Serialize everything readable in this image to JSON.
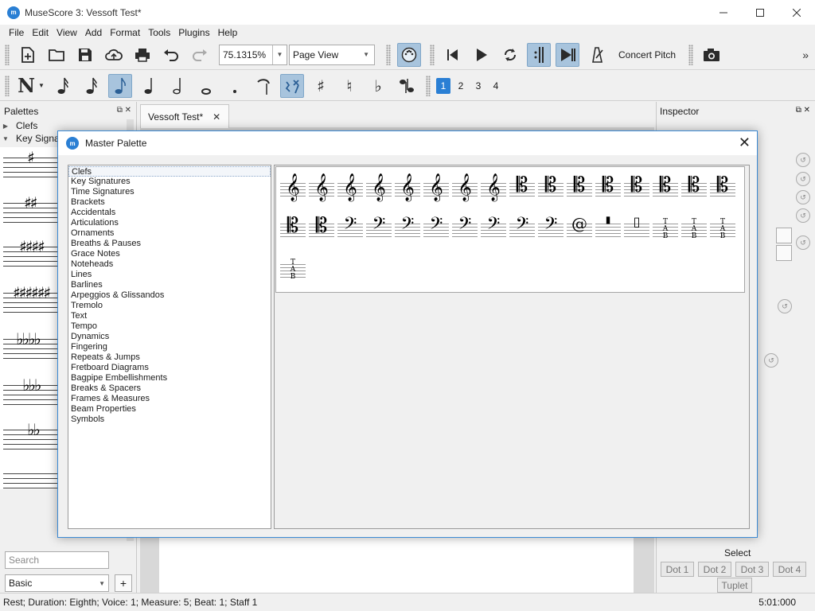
{
  "window": {
    "title": "MuseScore 3: Vessoft Test*",
    "logo_text": "mı̀"
  },
  "menu": [
    "File",
    "Edit",
    "View",
    "Add",
    "Format",
    "Tools",
    "Plugins",
    "Help"
  ],
  "toolbar": {
    "zoom_value": "75.1315%",
    "view_mode": "Page View",
    "concert_pitch_label": "Concert Pitch",
    "voices": [
      "1",
      "2",
      "3",
      "4"
    ],
    "selected_voice": "1"
  },
  "palettes_panel": {
    "title": "Palettes",
    "tree": [
      {
        "label": "Clefs",
        "expanded": false
      },
      {
        "label": "Key Signat",
        "expanded": true
      }
    ],
    "search_placeholder": "Search",
    "workspace": "Basic",
    "add_label": "+"
  },
  "score_tab": {
    "label": "Vessoft Test*"
  },
  "inspector": {
    "title": "Inspector",
    "select_label": "Select",
    "dot_buttons": [
      "Dot 1",
      "Dot 2",
      "Dot 3",
      "Dot 4"
    ],
    "tuplet_label": "Tuplet"
  },
  "master_palette": {
    "title": "Master Palette",
    "categories": [
      "Clefs",
      "Key Signatures",
      "Time Signatures",
      "Brackets",
      "Accidentals",
      "Articulations",
      "Ornaments",
      "Breaths & Pauses",
      "Grace Notes",
      "Noteheads",
      "Lines",
      "Barlines",
      "Arpeggios & Glissandos",
      "Tremolo",
      "Text",
      "Tempo",
      "Dynamics",
      "Fingering",
      "Repeats & Jumps",
      "Fretboard Diagrams",
      "Bagpipe Embellishments",
      "Breaks & Spacers",
      "Frames & Measures",
      "Beam Properties",
      "Symbols"
    ],
    "selected_category": "Clefs"
  },
  "status": {
    "left": "Rest; Duration: Eighth; Voice: 1;  Measure: 5; Beat: 1; Staff 1",
    "right": "5:01:000"
  },
  "colors": {
    "accent": "#2a7fd4",
    "active_button": "#a8c4dd",
    "dialog_border": "#3c8ad4"
  }
}
